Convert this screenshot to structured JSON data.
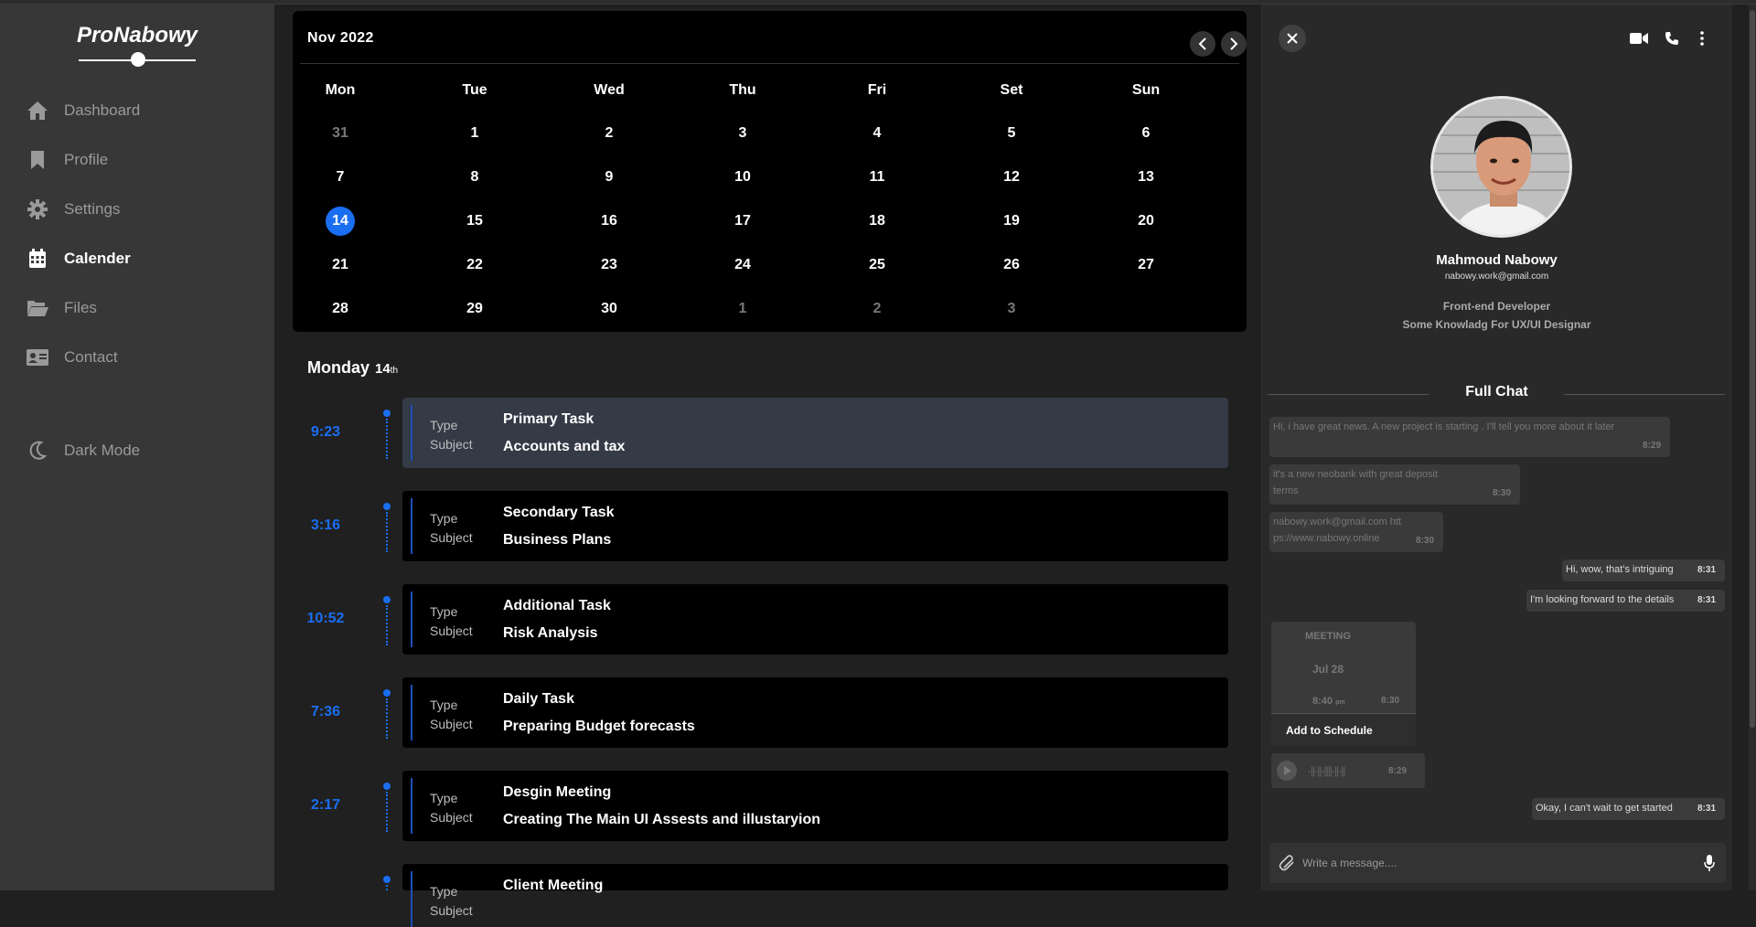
{
  "app": {
    "logo": "ProNabowy"
  },
  "sidebar": {
    "items": [
      {
        "label": "Dashboard",
        "icon": "home-icon",
        "active": false
      },
      {
        "label": "Profile",
        "icon": "bookmark-icon",
        "active": false
      },
      {
        "label": "Settings",
        "icon": "gear-icon",
        "active": false
      },
      {
        "label": "Calender",
        "icon": "calendar-icon",
        "active": true
      },
      {
        "label": "Files",
        "icon": "folder-icon",
        "active": false
      },
      {
        "label": "Contact",
        "icon": "contact-card-icon",
        "active": false
      }
    ],
    "dark_mode_label": "Dark Mode"
  },
  "calendar": {
    "month_label": "Nov  2022",
    "weekdays": [
      "Mon",
      "Tue",
      "Wed",
      "Thu",
      "Fri",
      "Set",
      "Sun"
    ],
    "weeks": [
      [
        {
          "d": "31",
          "muted": true
        },
        {
          "d": "1"
        },
        {
          "d": "2"
        },
        {
          "d": "3"
        },
        {
          "d": "4"
        },
        {
          "d": "5"
        },
        {
          "d": "6"
        }
      ],
      [
        {
          "d": "7"
        },
        {
          "d": "8"
        },
        {
          "d": "9"
        },
        {
          "d": "10"
        },
        {
          "d": "11"
        },
        {
          "d": "12"
        },
        {
          "d": "13"
        }
      ],
      [
        {
          "d": "14",
          "today": true
        },
        {
          "d": "15"
        },
        {
          "d": "16"
        },
        {
          "d": "17"
        },
        {
          "d": "18"
        },
        {
          "d": "19"
        },
        {
          "d": "20"
        }
      ],
      [
        {
          "d": "21"
        },
        {
          "d": "22"
        },
        {
          "d": "23"
        },
        {
          "d": "24"
        },
        {
          "d": "25"
        },
        {
          "d": "26"
        },
        {
          "d": "27"
        }
      ],
      [
        {
          "d": "28"
        },
        {
          "d": "29"
        },
        {
          "d": "30"
        },
        {
          "d": "1",
          "muted": true
        },
        {
          "d": "2",
          "muted": true
        },
        {
          "d": "3",
          "muted": true
        }
      ]
    ]
  },
  "schedule": {
    "day_name": "Monday",
    "day_num": "14",
    "day_suffix": "th",
    "type_label": "Type",
    "subject_label": "Subject",
    "tasks": [
      {
        "time": "9:23",
        "type": "Primary Task",
        "subject": "Accounts and tax",
        "highlight": true
      },
      {
        "time": "3:16",
        "type": "Secondary Task",
        "subject": "Business Plans"
      },
      {
        "time": "10:52",
        "type": "Additional Task",
        "subject": "Risk Analysis"
      },
      {
        "time": "7:36",
        "type": "Daily Task",
        "subject": "Preparing Budget forecasts"
      },
      {
        "time": "2:17",
        "type": "Desgin Meeting",
        "subject": "Creating The Main UI Assests and illustaryion"
      },
      {
        "time": "",
        "type": "Client Meeting",
        "subject": ""
      }
    ]
  },
  "chat": {
    "profile": {
      "name": "Mahmoud Nabowy",
      "email": "nabowy.work@gmail.com",
      "role": "Front-end Developer",
      "note": "Some Knowladg For UX/UI Designar"
    },
    "full_chat_label": "Full Chat",
    "messages": [
      {
        "text": "Hi, i have great news. A new project is starting . I'll tell you more about it later",
        "time": "8:29",
        "out": false
      },
      {
        "text": "it's a new neobank with great deposit terms",
        "time": "8:30",
        "out": false
      },
      {
        "text": "nabowy.work@gmail.com https://www.nabowy.online",
        "time": "8:30",
        "out": false
      },
      {
        "text": "Hi, wow, that's intriguing",
        "time": "8:31",
        "out": true
      },
      {
        "text": "I'm looking forward to the details",
        "time": "8:31",
        "out": true
      },
      {
        "text": "Okay, I can't wait to get started",
        "time": "8:31",
        "out": true
      }
    ],
    "meeting": {
      "title": "MEETING",
      "date": "Jul 28",
      "time": "8:40",
      "time_suffix": "pm",
      "sent": "8:30",
      "action": "Add to Schedule"
    },
    "audio": {
      "waveform": "-||-||-||||-||-||",
      "time": "8:29"
    },
    "composer": {
      "placeholder": "Write a message...."
    }
  }
}
